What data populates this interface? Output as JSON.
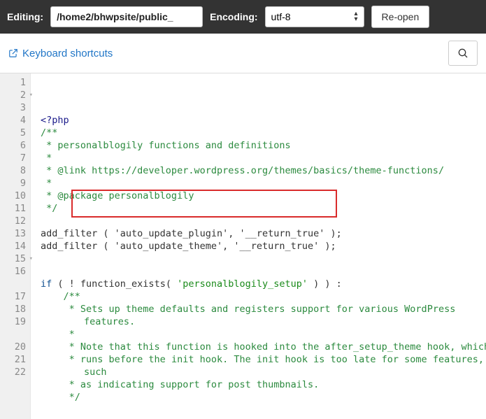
{
  "topbar": {
    "editing_label": "Editing:",
    "path_value": "/home2/bhwpsite/public_",
    "encoding_label": "Encoding:",
    "encoding_value": "utf-8",
    "reopen_label": "Re-open"
  },
  "subbar": {
    "keyboard_shortcuts": "Keyboard shortcuts"
  },
  "code": {
    "lines": [
      {
        "n": 1,
        "html": "<span class='c-tag'>&lt;?php</span>"
      },
      {
        "n": 2,
        "fold": true,
        "html": "<span class='c-cmt'>/**</span>"
      },
      {
        "n": 3,
        "html": "<span class='c-cmt'> * personalblogily functions and definitions</span>"
      },
      {
        "n": 4,
        "html": "<span class='c-cmt'> *</span>"
      },
      {
        "n": 5,
        "html": "<span class='c-cmt'> * @link https://developer.wordpress.org/themes/basics/theme-functions/</span>"
      },
      {
        "n": 6,
        "html": "<span class='c-cmt'> *</span>"
      },
      {
        "n": 7,
        "html": "<span class='c-cmt'> * @package personalblogily</span>"
      },
      {
        "n": 8,
        "html": "<span class='c-cmt'> */</span>"
      },
      {
        "n": 9,
        "html": ""
      },
      {
        "n": 10,
        "html": "add_filter ( 'auto_update_plugin', '__return_true' );"
      },
      {
        "n": 11,
        "html": "add_filter ( 'auto_update_theme', '__return_true' );"
      },
      {
        "n": 12,
        "html": ""
      },
      {
        "n": 13,
        "html": ""
      },
      {
        "n": 14,
        "html": "<span class='c-kw'>if</span> ( ! function_exists( <span class='c-str'>'personalblogily_setup'</span> ) ) :"
      },
      {
        "n": 15,
        "fold": true,
        "html": "    <span class='c-cmt'>/**</span>"
      },
      {
        "n": 16,
        "html": "    <span class='c-cmt'> * Sets up theme defaults and registers support for various WordPress</span>"
      },
      {
        "n": "",
        "wrap": true,
        "html": "<span class='c-cmt'>features.</span>"
      },
      {
        "n": 17,
        "html": "    <span class='c-cmt'> *</span>"
      },
      {
        "n": 18,
        "html": "    <span class='c-cmt'> * Note that this function is hooked into the after_setup_theme hook, which</span>"
      },
      {
        "n": 19,
        "html": "    <span class='c-cmt'> * runs before the init hook. The init hook is too late for some features,</span>"
      },
      {
        "n": "",
        "wrap": true,
        "html": "<span class='c-cmt'>such</span>"
      },
      {
        "n": 20,
        "html": "    <span class='c-cmt'> * as indicating support for post thumbnails.</span>"
      },
      {
        "n": 21,
        "html": "    <span class='c-cmt'> */</span>"
      },
      {
        "n": 22,
        "html": ""
      }
    ]
  }
}
